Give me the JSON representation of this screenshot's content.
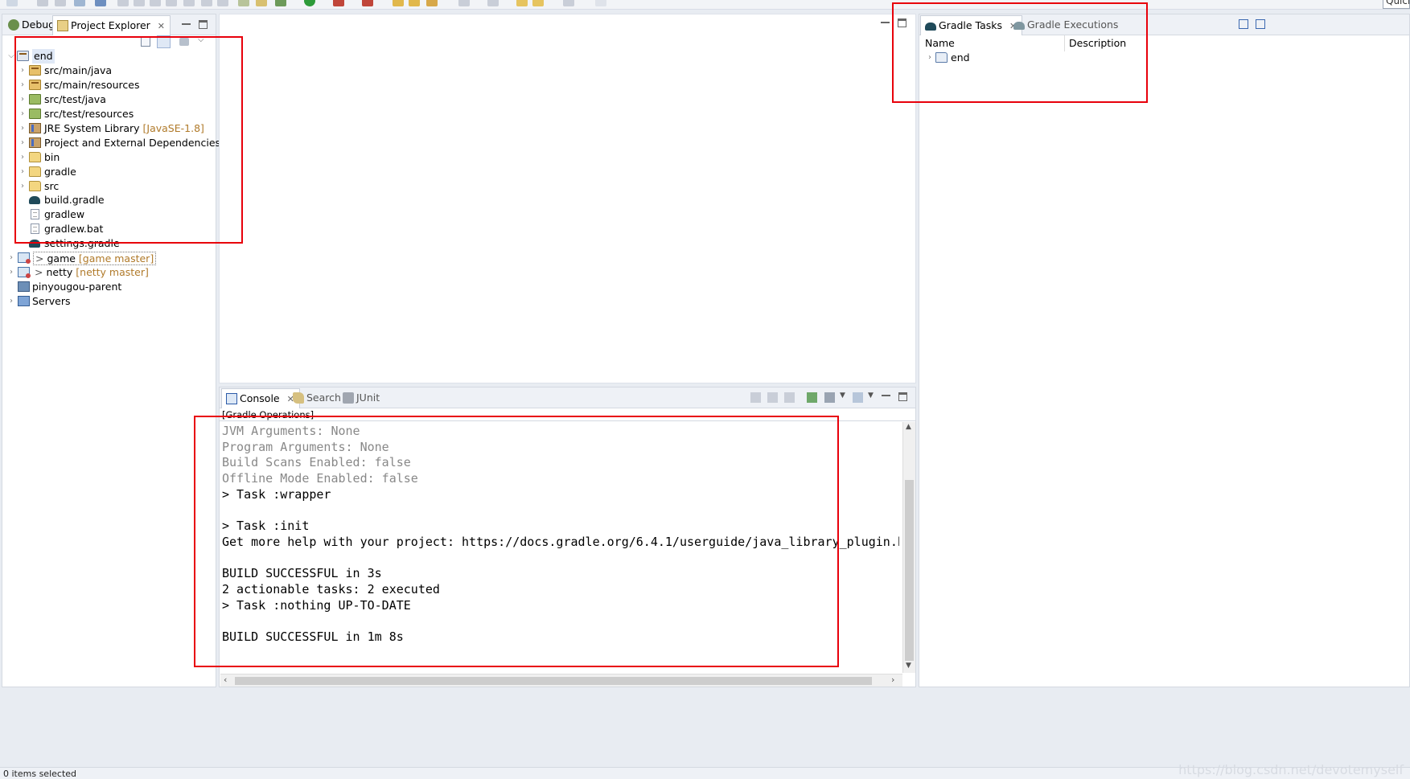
{
  "toolbar": {
    "quick_access": "Quick Access"
  },
  "left_panel": {
    "tabs": [
      {
        "label": "Debug",
        "icon": "debug-bug-icon"
      },
      {
        "label": "Project Explorer",
        "icon": "project-explorer-icon"
      }
    ],
    "tree": [
      {
        "label": "end",
        "icon": "gradle-project-icon",
        "expanded": true
      },
      {
        "label": "src/main/java",
        "icon": "source-folder-icon"
      },
      {
        "label": "src/main/resources",
        "icon": "source-folder-icon"
      },
      {
        "label": "src/test/java",
        "icon": "test-source-folder-icon"
      },
      {
        "label": "src/test/resources",
        "icon": "test-source-folder-icon"
      },
      {
        "label": "JRE System Library",
        "decoration": "[JavaSE-1.8]",
        "icon": "library-icon"
      },
      {
        "label": "Project and External Dependencies",
        "icon": "library-icon"
      },
      {
        "label": "bin",
        "icon": "folder-icon"
      },
      {
        "label": "gradle",
        "icon": "folder-icon"
      },
      {
        "label": "src",
        "icon": "folder-icon"
      },
      {
        "label": "build.gradle",
        "icon": "gradle-file-icon"
      },
      {
        "label": "gradlew",
        "icon": "file-icon"
      },
      {
        "label": "gradlew.bat",
        "icon": "file-icon"
      },
      {
        "label": "settings.gradle",
        "icon": "gradle-file-icon"
      },
      {
        "label": "game",
        "git_mark": ">",
        "decoration": "[game master]",
        "icon": "git-project-icon"
      },
      {
        "label": "netty",
        "git_mark": ">",
        "decoration": "[netty master]",
        "icon": "git-project-icon"
      },
      {
        "label": "pinyougou-parent",
        "icon": "project-icon"
      },
      {
        "label": "Servers",
        "icon": "servers-folder-icon"
      }
    ]
  },
  "gradle_panel": {
    "tabs": [
      {
        "label": "Gradle Tasks",
        "icon": "gradle-elephant-icon"
      },
      {
        "label": "Gradle Executions",
        "icon": "gradle-elephant-icon"
      }
    ],
    "columns": [
      "Name",
      "Description"
    ],
    "rows": [
      {
        "label": "end",
        "icon": "gradle-project-icon"
      }
    ]
  },
  "console_panel": {
    "tabs": [
      {
        "label": "Console",
        "icon": "console-icon"
      },
      {
        "label": "Search",
        "icon": "search-icon"
      },
      {
        "label": "JUnit",
        "icon": "junit-icon"
      }
    ],
    "header": "[Gradle Operations]",
    "lines": [
      {
        "text": "JVM Arguments: None",
        "muted": true
      },
      {
        "text": "Program Arguments: None",
        "muted": true
      },
      {
        "text": "Build Scans Enabled: false",
        "muted": true
      },
      {
        "text": "Offline Mode Enabled: false",
        "muted": true
      },
      {
        "text": "> Task :wrapper",
        "muted": false
      },
      {
        "text": "",
        "muted": false
      },
      {
        "text": "> Task :init",
        "muted": false
      },
      {
        "text": "Get more help with your project: https://docs.gradle.org/6.4.1/userguide/java_library_plugin.html",
        "muted": false
      },
      {
        "text": "",
        "muted": false
      },
      {
        "text": "BUILD SUCCESSFUL in 3s",
        "muted": false
      },
      {
        "text": "2 actionable tasks: 2 executed",
        "muted": false
      },
      {
        "text": "> Task :nothing UP-TO-DATE",
        "muted": false
      },
      {
        "text": "",
        "muted": false
      },
      {
        "text": "BUILD SUCCESSFUL in 1m 8s",
        "muted": false
      }
    ]
  },
  "status_bar": {
    "text": "0 items selected"
  },
  "watermark": "https://blog.csdn.net/devotemyself",
  "colors": {
    "highlight_box": "#e8000b",
    "decoration": "#b07a2a",
    "muted_text": "#888888"
  }
}
